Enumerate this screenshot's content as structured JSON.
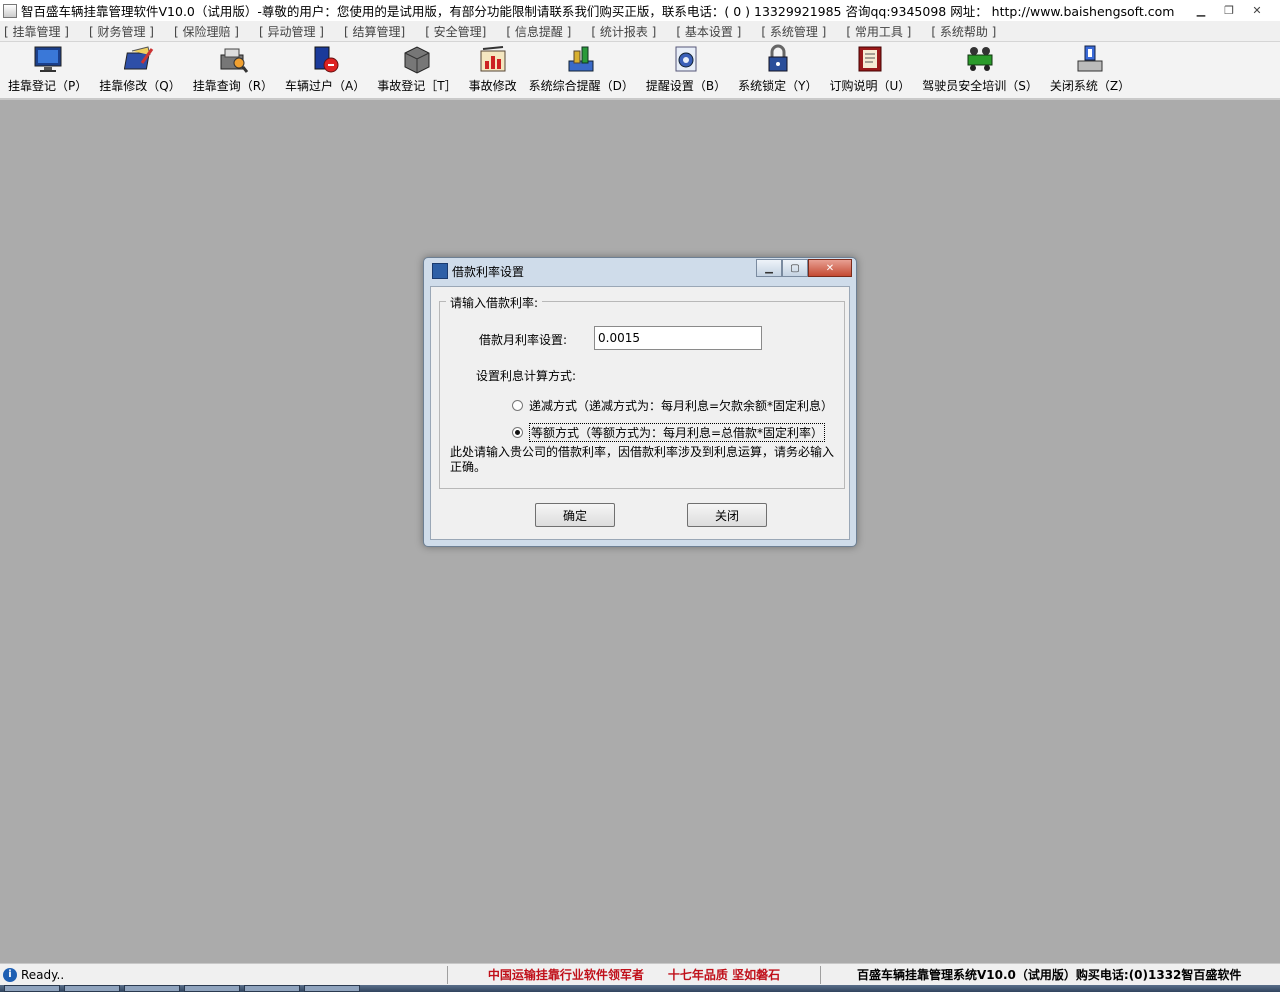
{
  "window": {
    "title": "智百盛车辆挂靠管理软件V10.0（试用版）-尊敬的用户：您使用的是试用版，有部分功能限制请联系我们购买正版，联系电话：( 0 ) 13329921985  咨询qq:9345098   网址：  http://www.baishengsoft.com"
  },
  "menu": [
    "[ 挂靠管理 ]",
    "[ 财务管理 ]",
    "[ 保险理赔 ]",
    "[ 异动管理 ]",
    "[ 结算管理]",
    "[ 安全管理]",
    "[ 信息提醒 ]",
    "[ 统计报表 ]",
    "[ 基本设置 ]",
    "[ 系统管理 ]",
    "[ 常用工具 ]",
    "[ 系统帮助 ]"
  ],
  "toolbar": [
    {
      "label": "挂靠登记（P）",
      "icon": "monitor-icon"
    },
    {
      "label": "挂靠修改（Q）",
      "icon": "edit-document-icon"
    },
    {
      "label": "挂靠查询（R）",
      "icon": "search-printer-icon"
    },
    {
      "label": "车辆过户（A）",
      "icon": "transfer-icon"
    },
    {
      "label": "事故登记［T］",
      "icon": "box-icon"
    },
    {
      "label": "事故修改",
      "icon": "chart-icon"
    },
    {
      "label": "系统综合提醒（D）",
      "icon": "reminder-icon"
    },
    {
      "label": "提醒设置（B）",
      "icon": "gear-icon"
    },
    {
      "label": "系统锁定（Y）",
      "icon": "lock-icon"
    },
    {
      "label": "订购说明（U）",
      "icon": "book-icon"
    },
    {
      "label": "驾驶员安全培训（S）",
      "icon": "vehicle-icon"
    },
    {
      "label": "关闭系统（Z）",
      "icon": "disk-exit-icon"
    }
  ],
  "dialog": {
    "title": "借款利率设置",
    "group_legend": "请输入借款利率:",
    "rate_label": "借款月利率设置:",
    "rate_value": "0.0015",
    "method_label": "设置利息计算方式:",
    "option_declining": "递减方式（递减方式为：每月利息=欠款余额*固定利息）",
    "option_equal": "等额方式（等额方式为：每月利息=总借款*固定利率）",
    "selected_option": "equal",
    "note": "此处请输入贵公司的借款利率，因借款利率涉及到利息运算，请务必输入正确。",
    "ok_label": "确定",
    "close_label": "关闭"
  },
  "status": {
    "ready": "Ready..",
    "slogan": "中国运输挂靠行业软件领军者　　十七年品质 坚如磐石",
    "product": "百盛车辆挂靠管理系统V10.0（试用版）购买电话:(0)1332智百盛软件"
  }
}
